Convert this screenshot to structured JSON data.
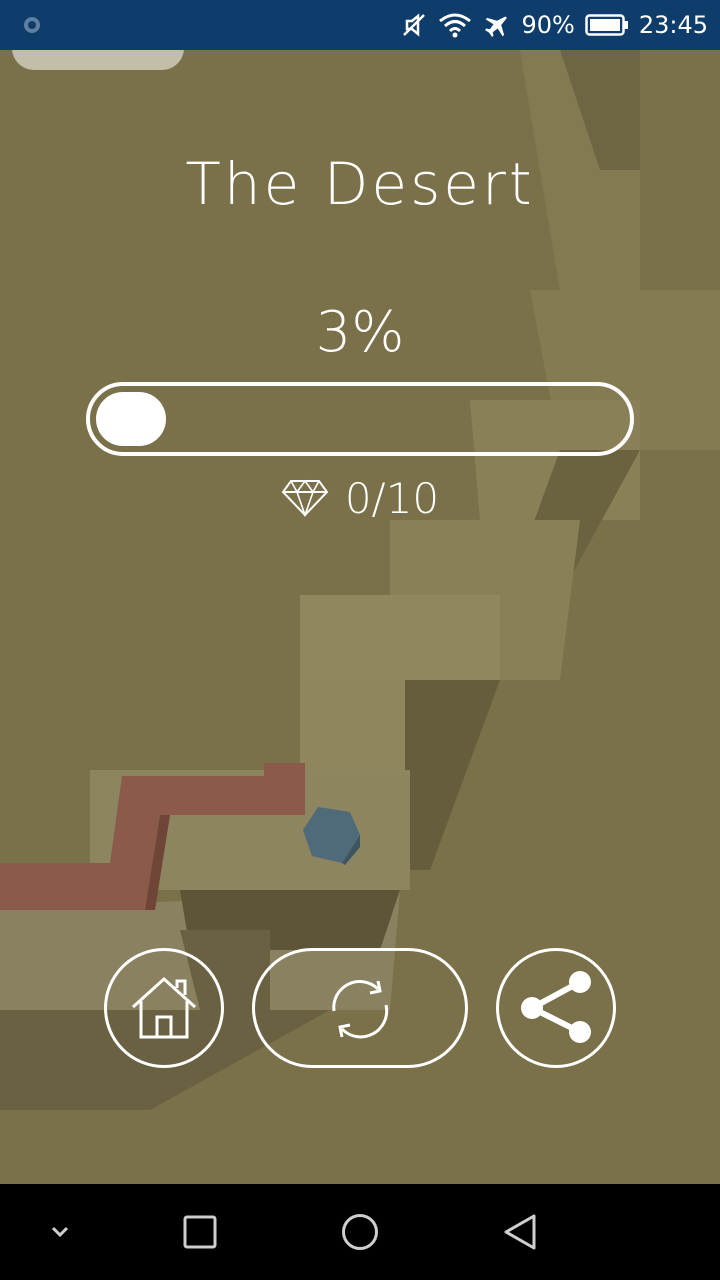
{
  "status_bar": {
    "battery_percent": "90%",
    "time": "23:45",
    "icons": [
      "notification-dot-icon",
      "mute-icon",
      "wifi-icon",
      "airplane-icon",
      "battery-icon"
    ]
  },
  "level": {
    "title": "The Desert",
    "progress_text": "3%",
    "progress_value": 0.03
  },
  "gems": {
    "text": "0/10",
    "icon": "diamond-icon"
  },
  "buttons": {
    "home_icon": "home-icon",
    "retry_icon": "retry-icon",
    "share_icon": "share-icon"
  },
  "nav_bar": {
    "icons": [
      "collapse-icon",
      "recents-icon",
      "home-circle-icon",
      "back-icon"
    ]
  },
  "colors": {
    "background": "#7a7049",
    "status_bar": "#0f3d6b",
    "path_red": "#8b5a4a",
    "block_light": "#8f875f",
    "ball": "#4f6a78",
    "foreground": "#ffffff"
  }
}
